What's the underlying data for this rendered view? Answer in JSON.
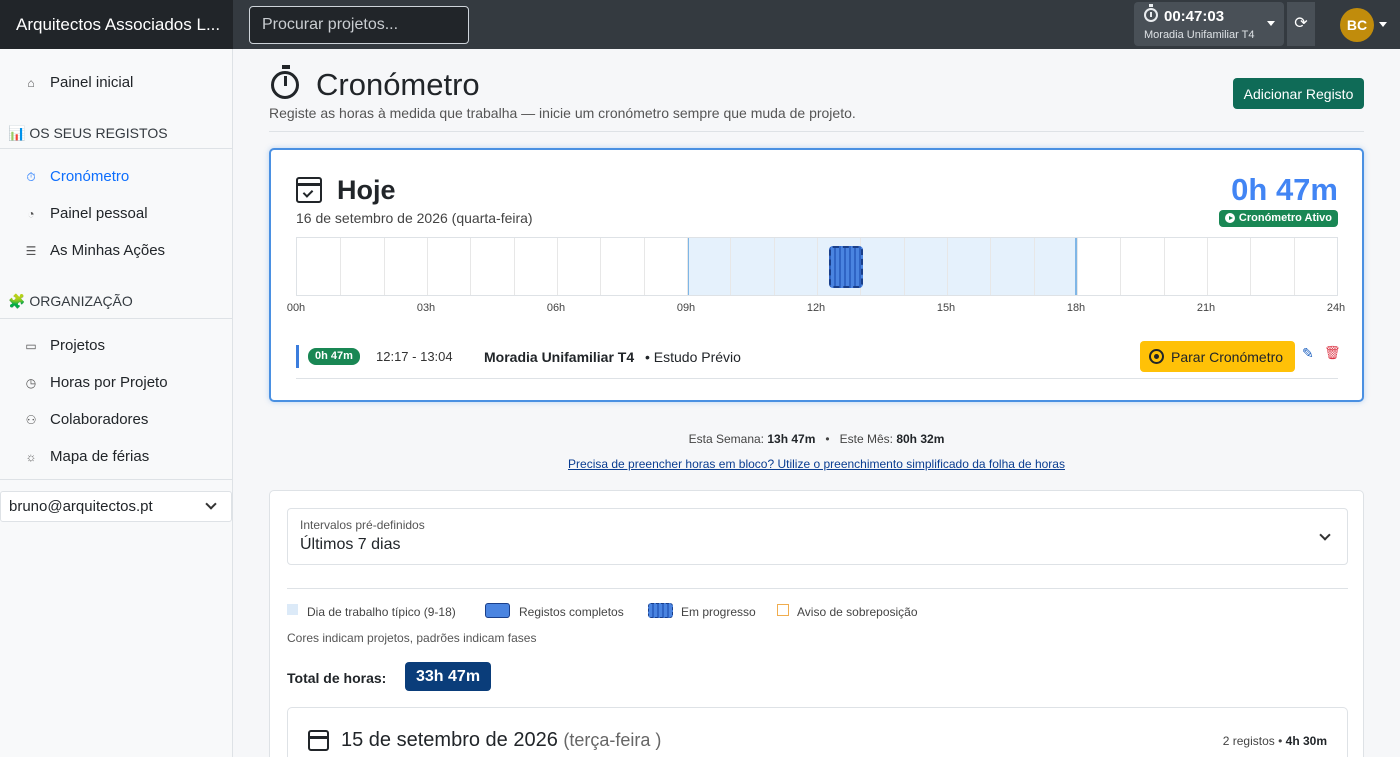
{
  "topbar": {
    "brand": "Arquitectos Associados L...",
    "search_placeholder": "Procurar projetos...",
    "timer": {
      "time": "00:47:03",
      "project": "Moradia Unifamiliar T4"
    },
    "avatar_initials": "BC"
  },
  "sidebar": {
    "home": "Painel inicial",
    "section_records": "📊 OS SEUS REGISTOS",
    "records_items": [
      {
        "label": "Cronómetro",
        "icon": "stopwatch-icon",
        "glyph": "⏱"
      },
      {
        "label": "Painel pessoal",
        "icon": "pie-chart-icon",
        "glyph": "◔"
      },
      {
        "label": "As Minhas Ações",
        "icon": "list-icon",
        "glyph": "☰"
      }
    ],
    "section_org": "🧩 ORGANIZAÇÃO",
    "org_items": [
      {
        "label": "Projetos",
        "icon": "folder-icon",
        "glyph": "▭"
      },
      {
        "label": "Horas por Projeto",
        "icon": "clock-icon",
        "glyph": "◷"
      },
      {
        "label": "Colaboradores",
        "icon": "people-icon",
        "glyph": "⚇"
      },
      {
        "label": "Mapa de férias",
        "icon": "sun-icon",
        "glyph": "☼"
      }
    ],
    "user": "bruno@arquitectos.pt"
  },
  "page": {
    "title": "Cronómetro",
    "subtitle": "Registe as horas à medida que trabalha — inicie um cronómetro sempre que muda de projeto.",
    "add_button": "Adicionar Registo"
  },
  "today": {
    "title": "Hoje",
    "date": "16 de setembro de 2026  (quarta-feira)",
    "total": "0h 47m",
    "badge": "Cronómetro Ativo",
    "hour_ticks": [
      "00h",
      "03h",
      "06h",
      "09h",
      "12h",
      "15h",
      "18h",
      "21h",
      "24h"
    ],
    "workday_hours": [
      9,
      18
    ],
    "active_entry_hours": [
      12.283,
      13.067
    ],
    "entry": {
      "duration": "0h 47m",
      "range": "12:17 - 13:04",
      "project": "Moradia Unifamiliar T4",
      "phase": "• Estudo Prévio",
      "stop_label": "Parar Cronómetro"
    }
  },
  "summary": {
    "week_label": "Esta Semana:",
    "week_value": "13h 47m",
    "sep": "•",
    "month_label": "Este Mês:",
    "month_value": "80h 32m",
    "bulk_link": "Precisa de preencher horas em bloco? Utilize o preenchimento simplificado da folha de horas"
  },
  "history": {
    "range_label": "Intervalos pré-definidos",
    "range_value": "Últimos 7 dias",
    "legend": [
      "Dia de trabalho típico (9-18)",
      "Registos completos",
      "Em progresso",
      "Aviso de sobreposição"
    ],
    "note": "Cores indicam projetos, padrões indicam fases",
    "total_label": "Total de horas:",
    "total_value": "33h 47m",
    "day": {
      "title": "15 de setembro de 2026",
      "weekday": "(terça-feira )",
      "count": "2 registos",
      "sep": "•",
      "hours": "4h 30m"
    }
  }
}
